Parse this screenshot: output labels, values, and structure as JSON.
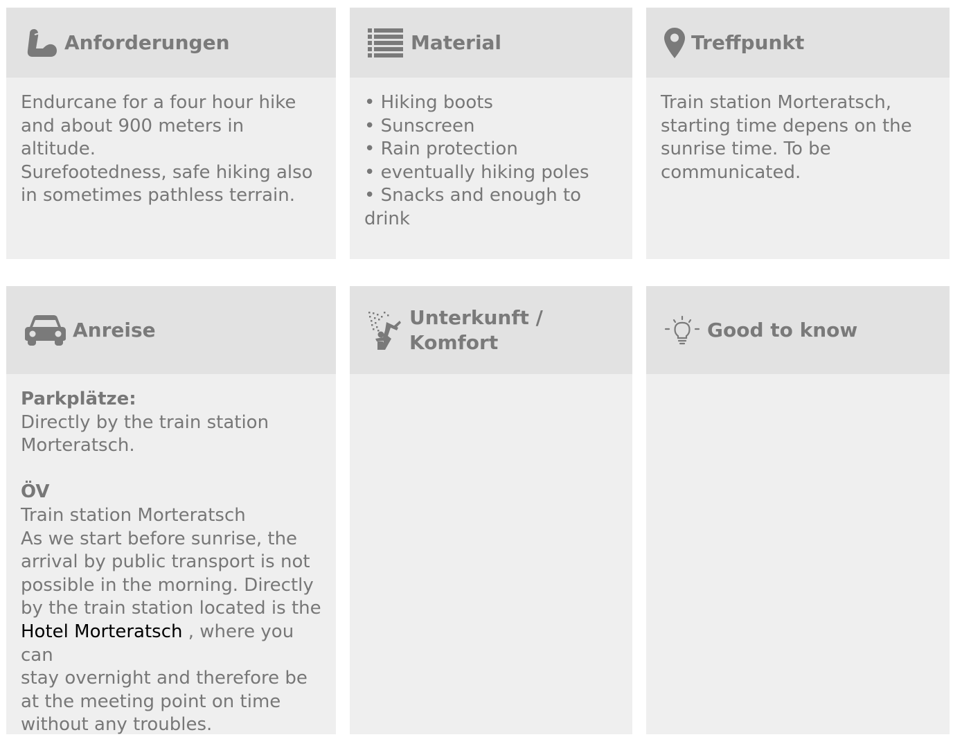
{
  "colors": {
    "page_background": "#ffffff",
    "header_background": "#e2e2e2",
    "body_background": "#efefef",
    "text": "#777777",
    "link": "#000000"
  },
  "cards": {
    "anforderungen": {
      "icon": "flexed-arm-icon",
      "title": "Anforderungen",
      "lines": [
        "Endurcane for a four hour hike",
        "and about 900 meters in altitude.",
        "Surefootedness, safe hiking also",
        "in sometimes pathless terrain."
      ]
    },
    "material": {
      "icon": "list-icon",
      "title": "Material",
      "items": [
        "Hiking boots",
        "Sunscreen",
        "Rain protection",
        "eventually hiking poles",
        "Snacks and enough to drink"
      ]
    },
    "treffpunkt": {
      "icon": "map-pin-icon",
      "title": "Treffpunkt",
      "lines": [
        "Train station Morteratsch,",
        "starting time depens on the",
        "sunrise time. To be",
        "communicated."
      ]
    },
    "anreise": {
      "icon": "car-icon",
      "title": "Anreise",
      "parking_title": "Parkplätze:",
      "parking_lines": [
        "Directly by the train station",
        "Morteratsch."
      ],
      "transport_title": "ÖV",
      "transport_lines": [
        "Train station Morteratsch",
        "As we start before sunrise, the",
        "arrival by public transport is not",
        "possible in the morning. Directly",
        "by the train station located is the"
      ],
      "hotel_link": "Hotel Morteratsch",
      "after_link": " , where you can",
      "closing_lines": [
        "stay overnight and therefore be",
        "at the meeting point on time",
        "without any troubles."
      ]
    },
    "unterkunft": {
      "icon": "shower-icon",
      "title_line1": "Unterkunft /",
      "title_line2": "Komfort"
    },
    "good_to_know": {
      "icon": "lightbulb-icon",
      "title": "Good to know"
    }
  }
}
